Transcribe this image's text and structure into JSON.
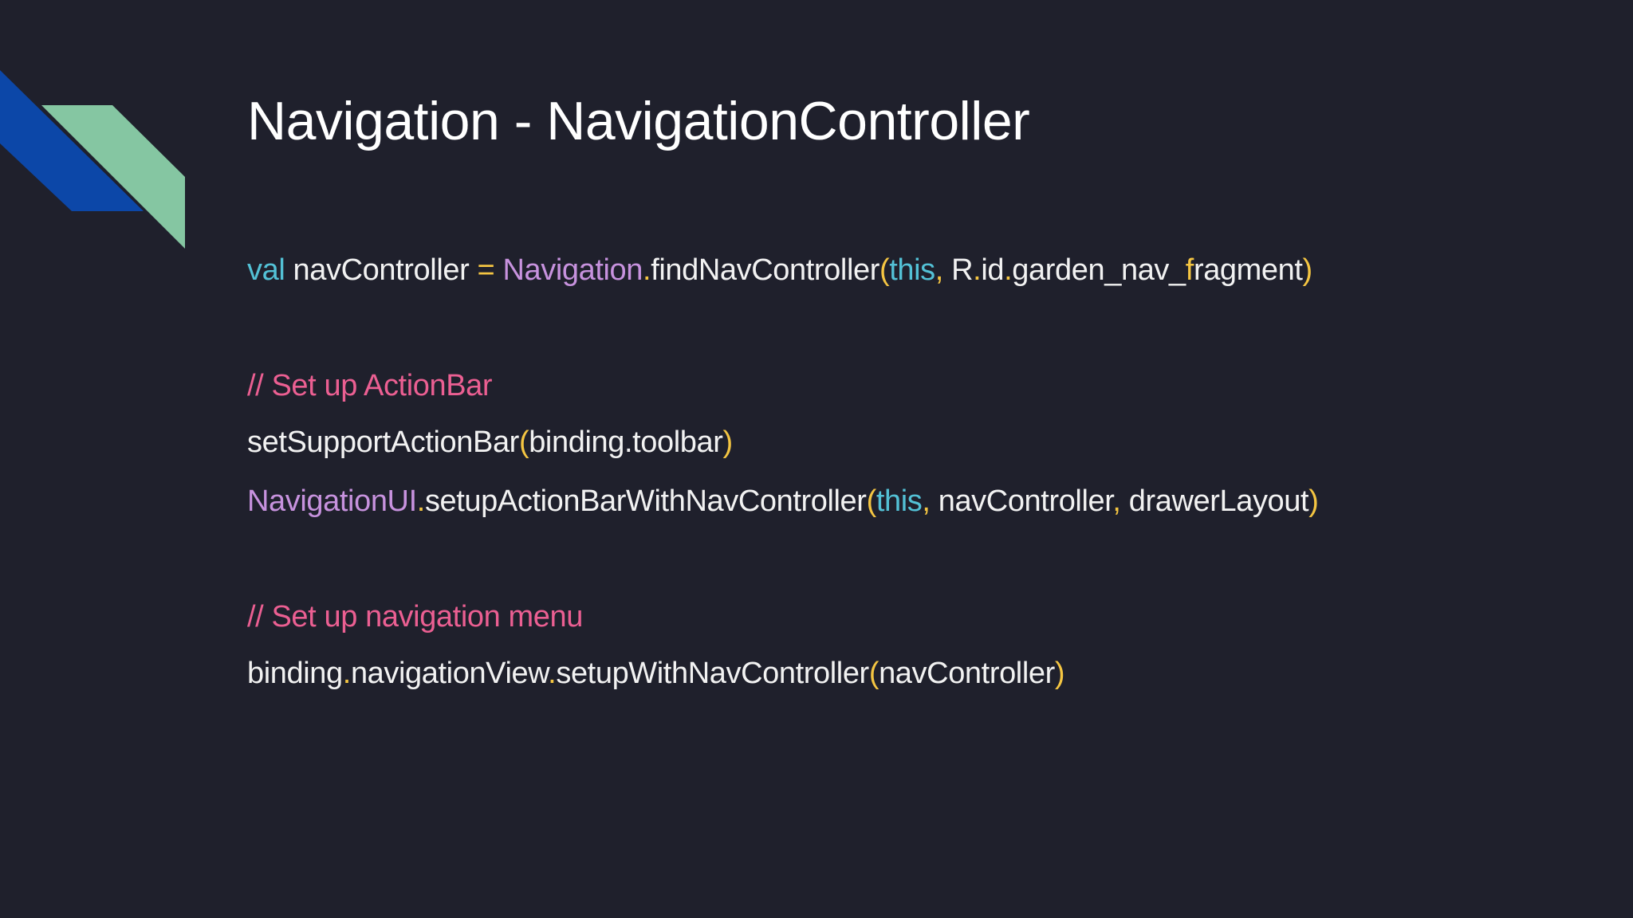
{
  "colors": {
    "background": "#1f202c",
    "deco_blue": "#0c47a8",
    "deco_green": "#85c6a2",
    "keyword": "#53c1d6",
    "class_name": "#c792de",
    "operator": "#f4c542",
    "identifier": "#f2f2f2",
    "comment": "#eb5f92"
  },
  "slide": {
    "title": "Navigation - NavigationController",
    "code": {
      "line1": {
        "kw_val": "val",
        "var": " navController ",
        "eq": "=",
        "cls": " Navigation",
        "dot": ".",
        "fn": "findNavController",
        "lp": "(",
        "this": "this",
        "comma": ",",
        "r": " R",
        "dot2": ".",
        "id": "id",
        "dot3": ".",
        "garden": "garden_nav_",
        "f": "f",
        "ragment": "ragment",
        "rp": ")"
      },
      "comment1": "// Set up ActionBar",
      "line3": {
        "fn": "setSupportActionBar",
        "lp": "(",
        "arg": "binding.toolbar",
        "rp": ")"
      },
      "line4": {
        "cls": "NavigationUI",
        "dot": ".",
        "fn": "setupActionBarWithNavController",
        "lp": "(",
        "this": "this",
        "comma1": ",",
        "arg2": " navController",
        "comma2": ",",
        "arg3": " drawerLayout",
        "rp": ")"
      },
      "comment2": "// Set up navigation menu",
      "line6": {
        "obj": "binding",
        "dot1": ".",
        "prop": "navigationView",
        "dot2": ".",
        "fn": "setupWithNavController",
        "lp": "(",
        "arg": "navController",
        "rp": ")"
      }
    }
  }
}
